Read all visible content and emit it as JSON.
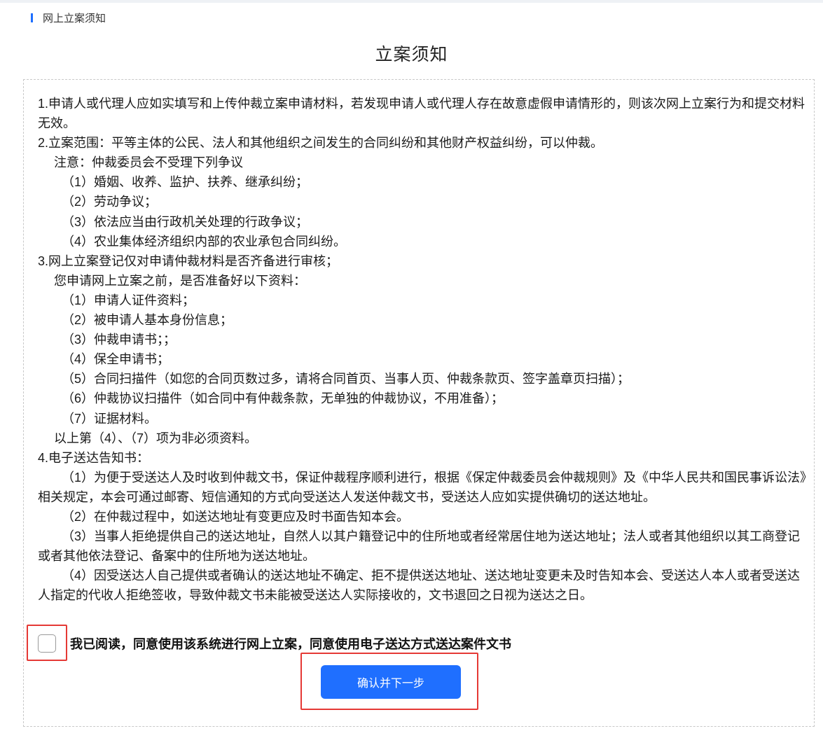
{
  "breadcrumb": {
    "label": "网上立案须知"
  },
  "page": {
    "title": "立案须知"
  },
  "notice": {
    "lines": [
      "1.申请人或代理人应如实填写和上传仲裁立案申请材料，若发现申请人或代理人存在故意虚假申请情形的，则该次网上立案行为和提交材料无效。",
      "2.立案范围：平等主体的公民、法人和其他组织之间发生的合同纠纷和其他财产权益纠纷，可以仲裁。",
      "注意：仲裁委员会不受理下列争议",
      "（1）婚姻、收养、监护、扶养、继承纠纷；",
      "（2）劳动争议；",
      "（3）依法应当由行政机关处理的行政争议；",
      "（4）农业集体经济组织内部的农业承包合同纠纷。",
      "3.网上立案登记仅对申请仲裁材料是否齐备进行审核；",
      "您申请网上立案之前，是否准备好以下资料：",
      "（1）申请人证件资料；",
      "（2）被申请人基本身份信息；",
      "（3）仲裁申请书；；",
      "（4）保全申请书；",
      "（5）合同扫描件（如您的合同页数过多，请将合同首页、当事人页、仲裁条款页、签字盖章页扫描）；",
      "（6）仲裁协议扫描件（如合同中有仲裁条款，无单独的仲裁协议，不用准备）；",
      "（7）证据材料。",
      "以上第（4）、（7）项为非必须资料。",
      "4.电子送达告知书：",
      "（1）为便于受送达人及时收到仲裁文书，保证仲裁程序顺利进行，根据《保定仲裁委员会仲裁规则》及《中华人民共和国民事诉讼法》相关规定，本会可通过邮寄、短信通知的方式向受送达人发送仲裁文书，受送达人应如实提供确切的送达地址。",
      "（2）在仲裁过程中，如送达地址有变更应及时书面告知本会。",
      "（3）当事人拒绝提供自己的送达地址，自然人以其户籍登记中的住所地或者经常居住地为送达地址；法人或者其他组织以其工商登记或者其他依法登记、备案中的住所地为送达地址。",
      "（4）因受送达人自己提供或者确认的送达地址不确定、拒不提供送达地址、送达地址变更未及时告知本会、受送达人本人或者受送达人指定的代收人拒绝签收，导致仲裁文书未能被受送达人实际接收的，文书退回之日视为送达之日。"
    ]
  },
  "consent": {
    "label": "我已阅读，同意使用该系统进行网上立案，同意使用电子送达方式送达案件文书",
    "checked": false
  },
  "actions": {
    "confirm_label": "确认并下一步"
  },
  "colors": {
    "accent": "#1f6fff",
    "highlight": "#e53935"
  }
}
